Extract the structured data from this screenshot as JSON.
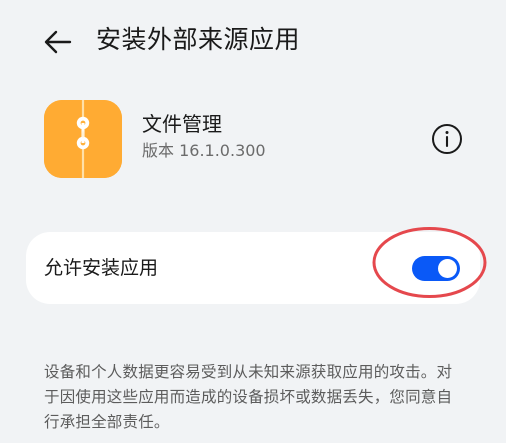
{
  "header": {
    "title": "安装外部来源应用",
    "back_icon": "back-arrow-icon"
  },
  "app": {
    "name": "文件管理",
    "version": "版本 16.1.0.300",
    "icon": "file-manager-app-icon",
    "info_icon": "info-icon"
  },
  "setting": {
    "label": "允许安装应用",
    "toggle_on": true
  },
  "warning": {
    "text": "设备和个人数据更容易受到从未知来源获取应用的攻击。对于因使用这些应用而造成的设备损坏或数据丢失，您同意自行承担全部责任。"
  },
  "colors": {
    "background": "#f1f3f5",
    "card": "#ffffff",
    "toggle_on": "#0a59f7",
    "annotation_ring": "#e5484d",
    "app_icon": "#ffaa32"
  }
}
